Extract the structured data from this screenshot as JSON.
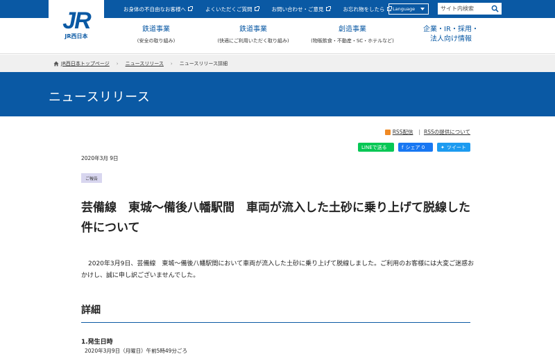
{
  "logo": {
    "mark": "JR",
    "sub": "JR西日本"
  },
  "top_links": [
    "お身体の不自由なお客様へ",
    "よくいただくご質問",
    "お問い合わせ・ご意見",
    "お忘れ物をしたら"
  ],
  "language": {
    "label": "Language"
  },
  "search": {
    "placeholder": "サイト内検索"
  },
  "nav": [
    {
      "title": "鉄道事業",
      "sub": "(安全の取り組み)"
    },
    {
      "title": "鉄道事業",
      "sub": "(快適にご利用いただく取り組み)"
    },
    {
      "title": "創造事業",
      "sub": "(物販飲食・不動産・SC・ホテルなど)"
    },
    {
      "title": "企業・IR・採用・",
      "title2": "法人向け情報"
    }
  ],
  "breadcrumb": {
    "home": "JR西日本トップページ",
    "news": "ニュースリリース",
    "current": "ニュースリリース詳細"
  },
  "banner": {
    "title": "ニュースリリース"
  },
  "rss": {
    "link1": "RSS配信",
    "link2": "RSSの提供について"
  },
  "share": {
    "line": "LINEで送る",
    "facebook": "シェア 0",
    "twitter": "ツイート"
  },
  "article": {
    "date": "2020年3月 9日",
    "tag": "ご報告",
    "headline": "芸備線　東城～備後八幡駅間　車両が流入した土砂に乗り上げて脱線した件について",
    "lead": "2020年3月9日、芸備線　東城～備後八幡駅間において車両が流入した土砂に乗り上げて脱線しました。ご利用のお客様には大変ご迷惑おかけし、誠に申し訳ございませんでした。",
    "section": "詳細",
    "sub_head": "1.発生日時",
    "sub_text": "2020年3月9日（月曜日）午前5時49分ごろ"
  },
  "colors": {
    "brand": "#0a59a4",
    "line": "#06c755",
    "facebook": "#1877f2",
    "twitter": "#1d9bf0",
    "rss": "#f08a24"
  }
}
